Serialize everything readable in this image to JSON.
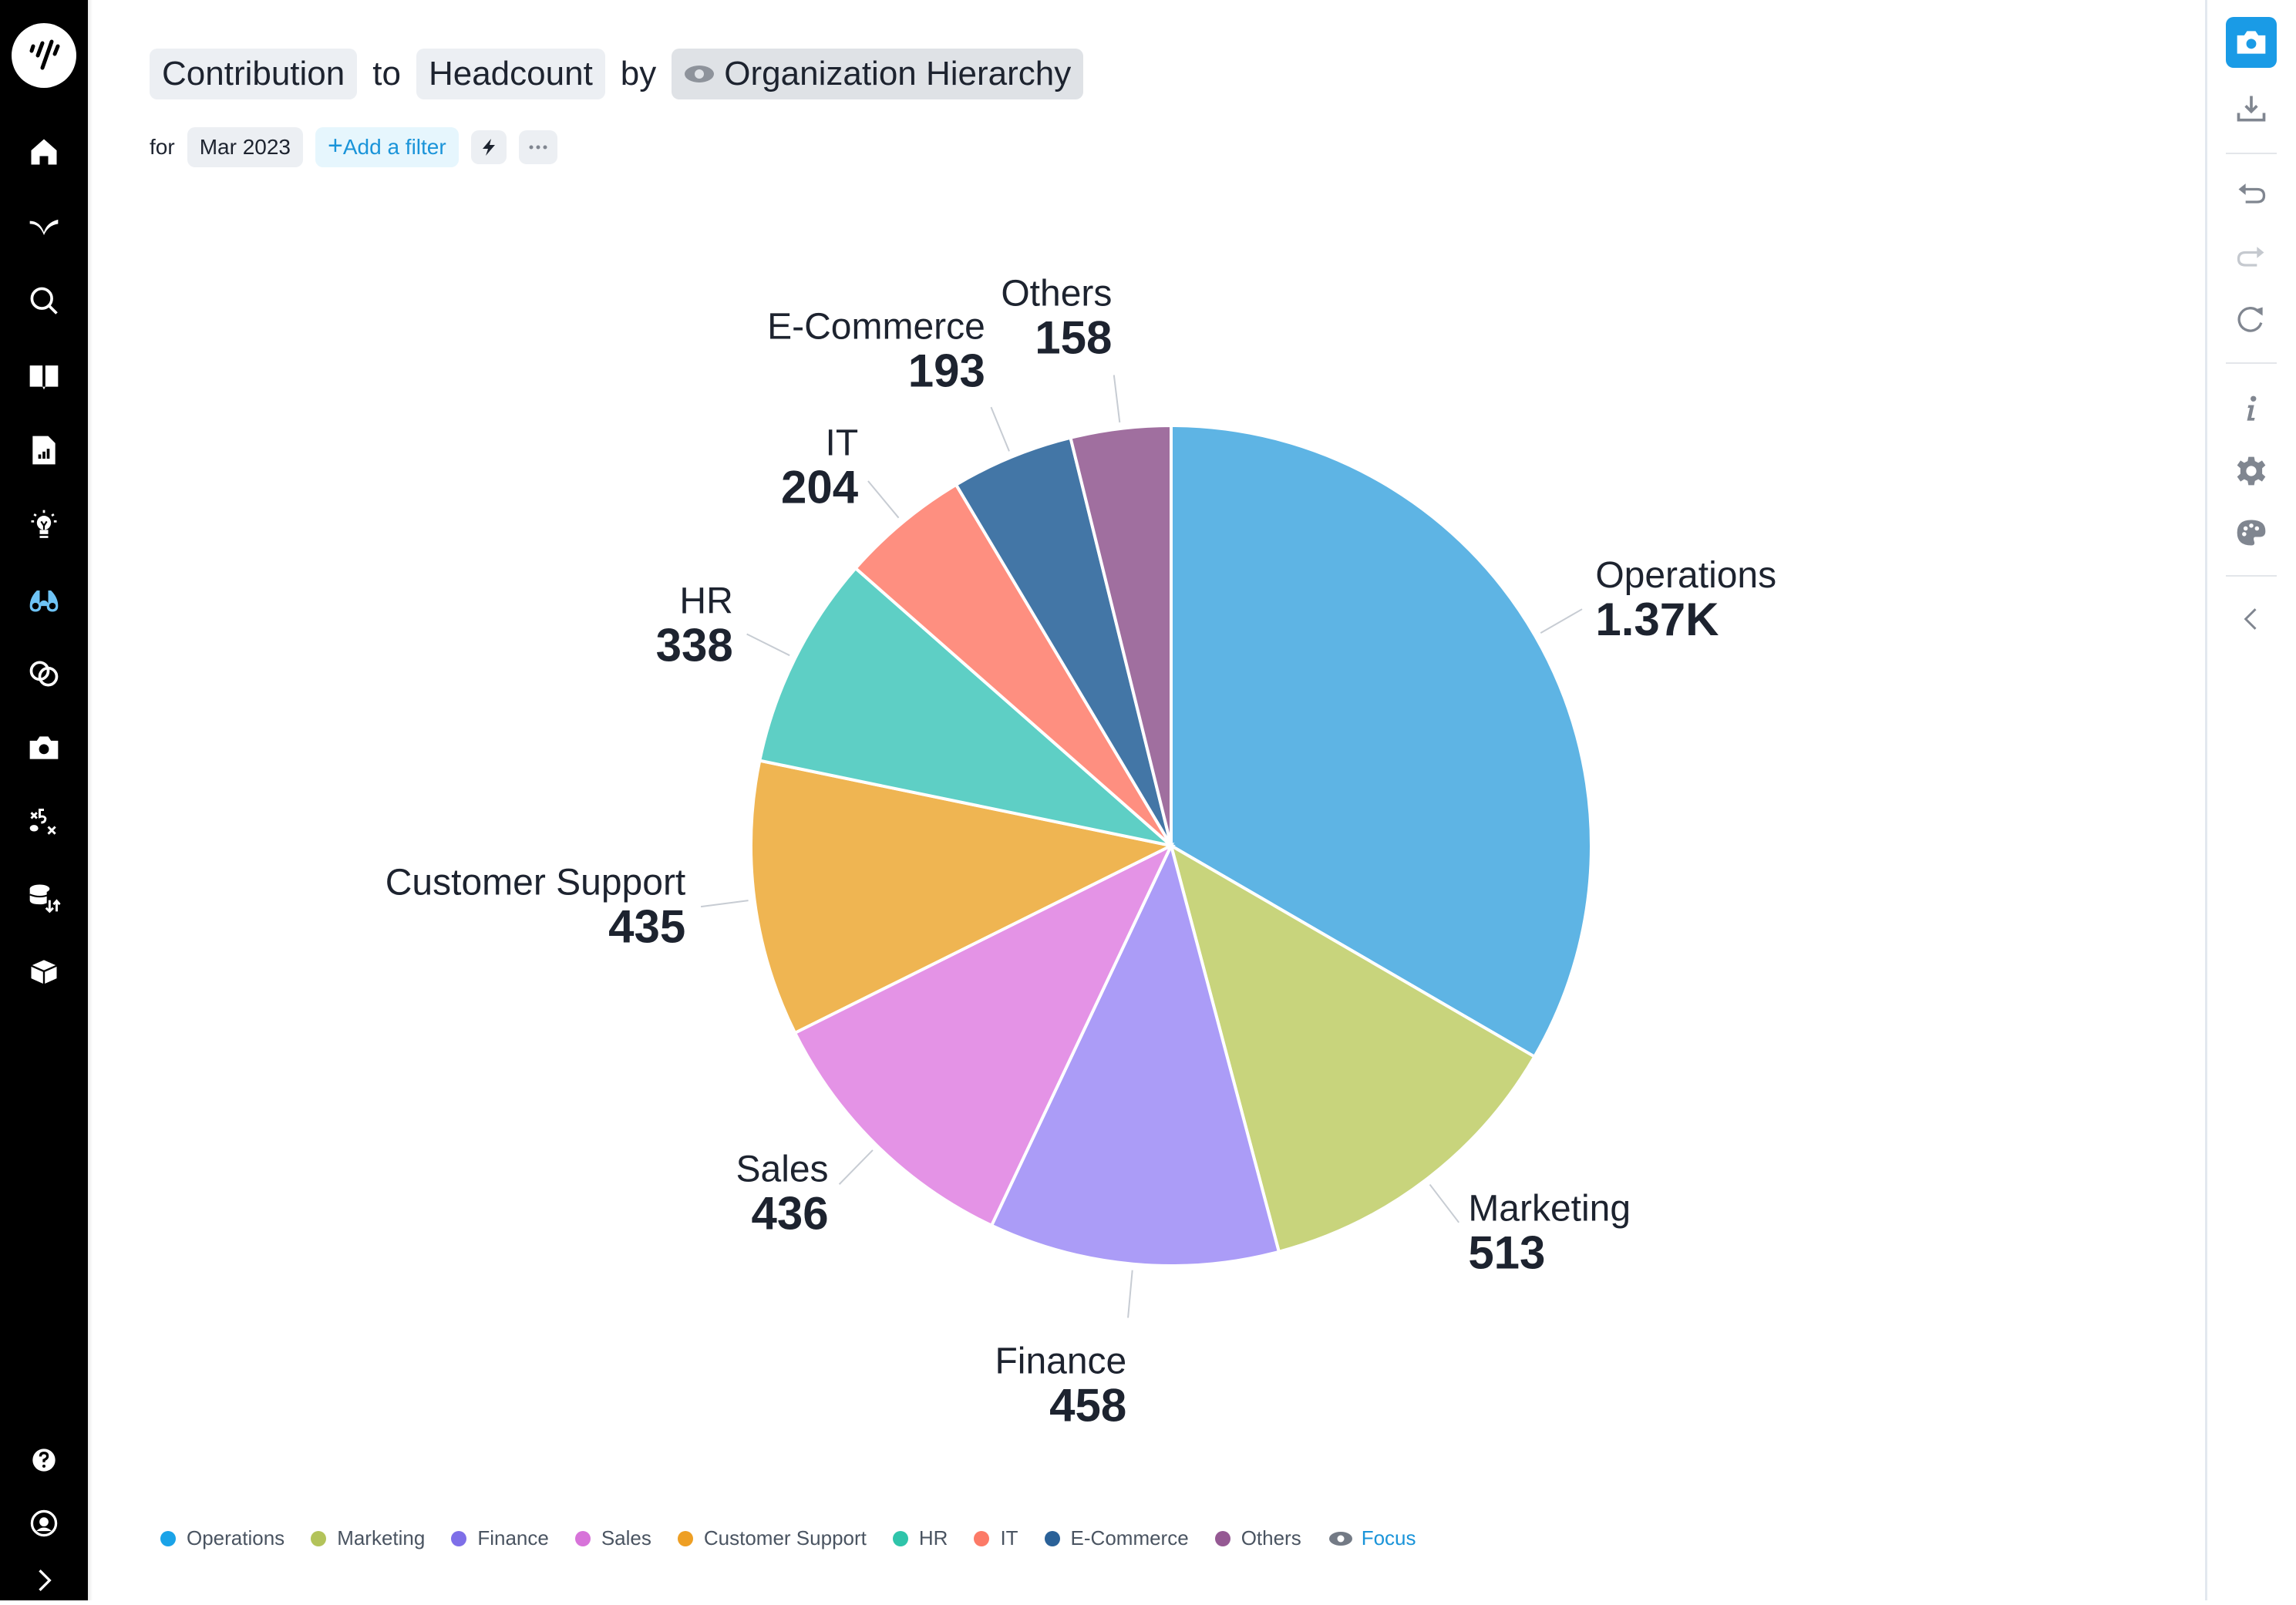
{
  "header": {
    "measure_prefix": "Contribution",
    "connector_to": "to",
    "measure": "Headcount",
    "connector_by": "by",
    "dimension": "Organization Hierarchy"
  },
  "filters": {
    "for_label": "for",
    "period": "Mar 2023",
    "add_filter_label": "Add a filter"
  },
  "legend": {
    "focus_label": "Focus"
  },
  "colors": {
    "accent": "#1a9be6",
    "nav_active": "#6ec3f5"
  },
  "chart_data": {
    "type": "pie",
    "title": "Contribution to Headcount by Organization Hierarchy",
    "start_angle_deg": 0,
    "direction": "clockwise",
    "legend_position": "bottom-left",
    "slices": [
      {
        "name": "Operations",
        "value": 1370,
        "display": "1.37K",
        "color": "#5eb4e4",
        "legend_color": "#1aa3e8"
      },
      {
        "name": "Marketing",
        "value": 513,
        "display": "513",
        "color": "#c8d47c",
        "legend_color": "#b3c35a"
      },
      {
        "name": "Finance",
        "value": 458,
        "display": "458",
        "color": "#ab9cf7",
        "legend_color": "#7e6fe8"
      },
      {
        "name": "Sales",
        "value": 436,
        "display": "436",
        "color": "#e493e6",
        "legend_color": "#d773d9"
      },
      {
        "name": "Customer Support",
        "value": 435,
        "display": "435",
        "color": "#efb552",
        "legend_color": "#ee9f24"
      },
      {
        "name": "HR",
        "value": 338,
        "display": "338",
        "color": "#5ecfc5",
        "legend_color": "#2fc4aa"
      },
      {
        "name": "IT",
        "value": 204,
        "display": "204",
        "color": "#fe8f80",
        "legend_color": "#fc7a67"
      },
      {
        "name": "E-Commerce",
        "value": 193,
        "display": "193",
        "color": "#4376a6",
        "legend_color": "#2a6198"
      },
      {
        "name": "Others",
        "value": 158,
        "display": "158",
        "color": "#a06f9f",
        "legend_color": "#955993"
      }
    ]
  }
}
